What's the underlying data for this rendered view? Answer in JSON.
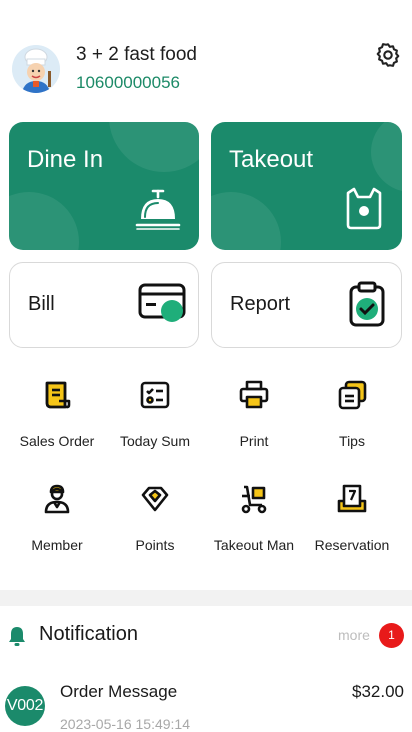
{
  "header": {
    "store_name": "3 + 2 fast food",
    "store_phone": "10600000056"
  },
  "main_cards": {
    "dine_in": "Dine In",
    "takeout": "Takeout",
    "bill": "Bill",
    "report": "Report"
  },
  "grid": [
    {
      "label": "Sales Order",
      "icon": "receipt-icon"
    },
    {
      "label": "Today Sum",
      "icon": "checklist-icon"
    },
    {
      "label": "Print",
      "icon": "printer-icon"
    },
    {
      "label": "Tips",
      "icon": "tips-icon"
    },
    {
      "label": "Member",
      "icon": "member-icon"
    },
    {
      "label": "Points",
      "icon": "diamond-icon"
    },
    {
      "label": "Takeout Man",
      "icon": "scooter-icon"
    },
    {
      "label": "Reservation",
      "icon": "calendar-icon"
    }
  ],
  "notification": {
    "title": "Notification",
    "more": "more",
    "badge_count": "1",
    "messages": [
      {
        "avatar_text": "V002",
        "title": "Order Message",
        "amount": "$32.00",
        "time": "2023-05-16 15:49:14"
      }
    ]
  },
  "colors": {
    "brand_green": "#1b8a6b",
    "accent_yellow": "#f5c518",
    "badge_red": "#e81a1a"
  }
}
